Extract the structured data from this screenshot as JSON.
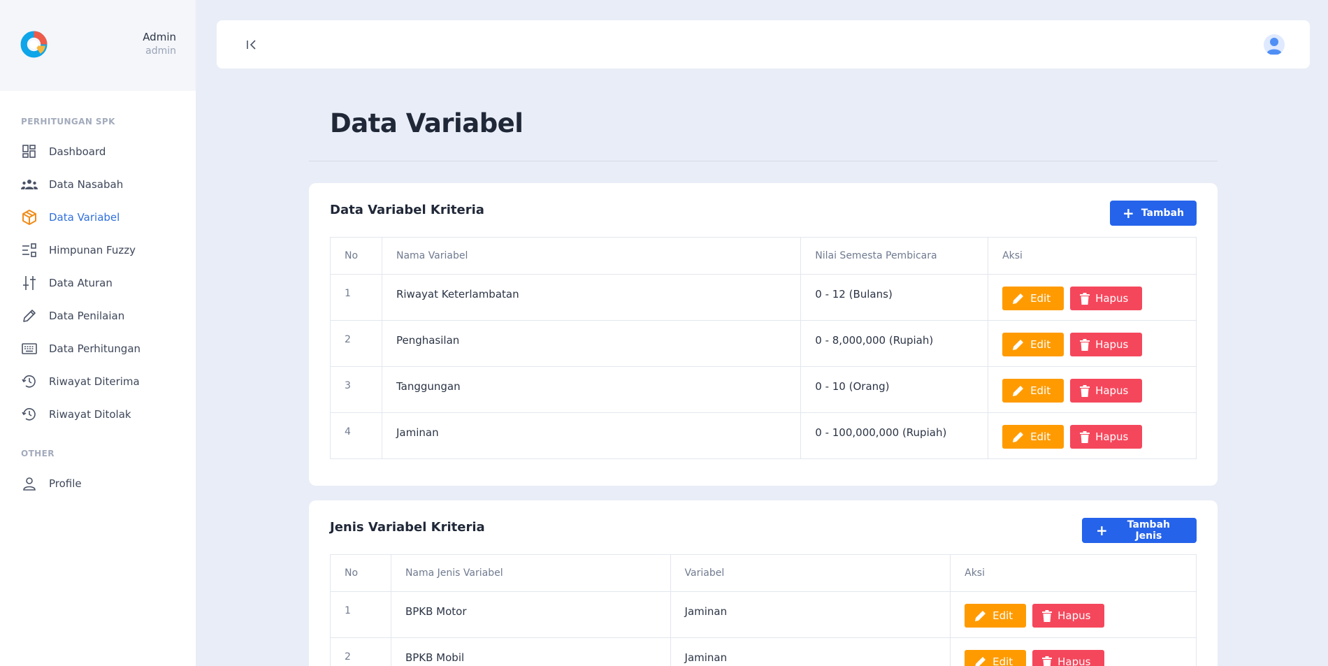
{
  "user": {
    "name": "Admin",
    "role": "admin"
  },
  "sidebar": {
    "section_main": "PERHITUNGAN SPK",
    "section_other": "OTHER",
    "items": [
      {
        "label": "Dashboard",
        "icon": "dashboard-icon",
        "active": false
      },
      {
        "label": "Data Nasabah",
        "icon": "users-icon",
        "active": false
      },
      {
        "label": "Data Variabel",
        "icon": "cube-icon",
        "active": true
      },
      {
        "label": "Himpunan Fuzzy",
        "icon": "filter-icon",
        "active": false
      },
      {
        "label": "Data Aturan",
        "icon": "sliders-icon",
        "active": false
      },
      {
        "label": "Data Penilaian",
        "icon": "pencil-icon",
        "active": false
      },
      {
        "label": "Data Perhitungan",
        "icon": "keyboard-icon",
        "active": false
      },
      {
        "label": "Riwayat Diterima",
        "icon": "history-icon",
        "active": false
      },
      {
        "label": "Riwayat Ditolak",
        "icon": "history-icon",
        "active": false
      }
    ],
    "other_items": [
      {
        "label": "Profile",
        "icon": "user-icon"
      }
    ]
  },
  "page": {
    "title": "Data Variabel"
  },
  "kriteria": {
    "title": "Data Variabel Kriteria",
    "add_label": "Tambah",
    "columns": [
      "No",
      "Nama Variabel",
      "Nilai Semesta Pembicara",
      "Aksi"
    ],
    "rows": [
      {
        "no": "1",
        "nama": "Riwayat Keterlambatan",
        "nilai": "0 - 12 (Bulans)"
      },
      {
        "no": "2",
        "nama": "Penghasilan",
        "nilai": "0 - 8,000,000 (Rupiah)"
      },
      {
        "no": "3",
        "nama": "Tanggungan",
        "nilai": "0 - 10 (Orang)"
      },
      {
        "no": "4",
        "nama": "Jaminan",
        "nilai": "0 - 100,000,000 (Rupiah)"
      }
    ]
  },
  "jenis": {
    "title": "Jenis Variabel Kriteria",
    "add_label": "Tambah Jenis",
    "columns": [
      "No",
      "Nama Jenis Variabel",
      "Variabel",
      "Aksi"
    ],
    "rows": [
      {
        "no": "1",
        "nama": "BPKB Motor",
        "variabel": "Jaminan"
      },
      {
        "no": "2",
        "nama": "BPKB Mobil",
        "variabel": "Jaminan"
      }
    ]
  },
  "actions": {
    "edit_label": "Edit",
    "delete_label": "Hapus"
  },
  "colors": {
    "primary": "#2563eb",
    "edit": "#ff9b00",
    "delete": "#f5475c",
    "active_nav": "#2f6fdc"
  }
}
